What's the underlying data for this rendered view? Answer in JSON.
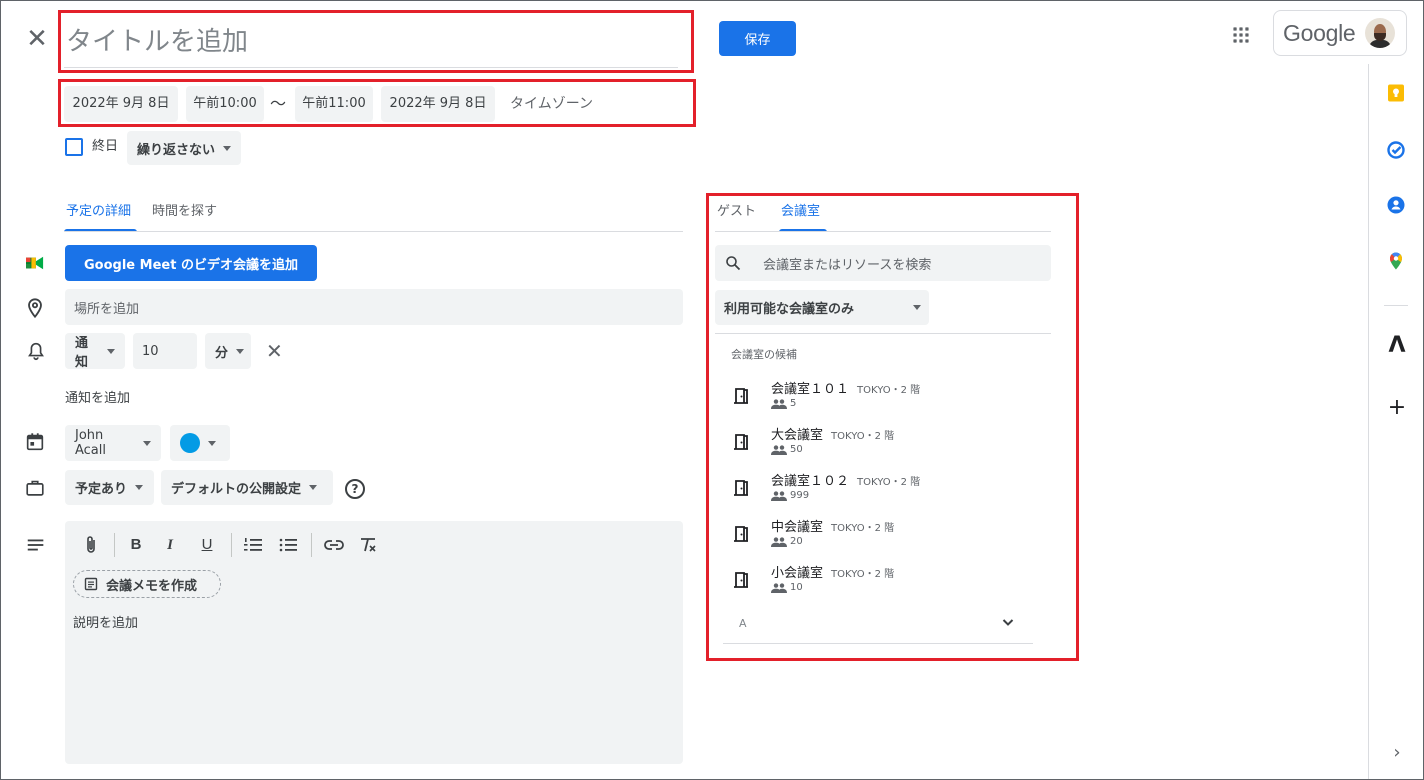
{
  "header": {
    "title_placeholder": "タイトルを追加",
    "save_label": "保存",
    "google_label": "Google"
  },
  "datetime": {
    "start_date": "2022年 9月 8日",
    "start_time": "午前10:00",
    "separator": "〜",
    "end_time": "午前11:00",
    "end_date": "2022年 9月 8日",
    "timezone": "タイムゾーン"
  },
  "options": {
    "all_day_label": "終日",
    "repeat_label": "繰り返さない"
  },
  "left_tabs": [
    {
      "label": "予定の詳細",
      "active": true
    },
    {
      "label": "時間を探す",
      "active": false
    }
  ],
  "details": {
    "meet_button": "Google Meet のビデオ会議を追加",
    "location_placeholder": "場所を追加",
    "notification_type": "通知",
    "notification_value": "10",
    "notification_unit": "分",
    "add_notification": "通知を追加",
    "calendar_owner": "John Acall",
    "calendar_color": "#039be5",
    "availability": "予定あり",
    "visibility": "デフォルトの公開設定",
    "help_glyph": "?"
  },
  "description": {
    "toolbar": [
      "attach-icon",
      "bold-icon",
      "italic-icon",
      "underline-icon",
      "numbered-list-icon",
      "bulleted-list-icon",
      "link-icon",
      "clear-format-icon"
    ],
    "toolbar_glyphs": {
      "bold": "B",
      "italic": "I",
      "underline": "U"
    },
    "notes_button": "会議メモを作成",
    "placeholder": "説明を追加"
  },
  "right_tabs": [
    {
      "label": "ゲスト",
      "active": false
    },
    {
      "label": "会議室",
      "active": true
    }
  ],
  "rooms_panel": {
    "search_placeholder": "会議室またはリソースを検索",
    "filter_label": "利用可能な会議室のみ",
    "section_label": "会議室の候補",
    "rooms": [
      {
        "name": "会議室１０１",
        "location": "TOKYO・2 階",
        "capacity": "5"
      },
      {
        "name": "大会議室",
        "location": "TOKYO・2 階",
        "capacity": "50"
      },
      {
        "name": "会議室１０２",
        "location": "TOKYO・2 階",
        "capacity": "999"
      },
      {
        "name": "中会議室",
        "location": "TOKYO・2 階",
        "capacity": "20"
      },
      {
        "name": "小会議室",
        "location": "TOKYO・2 階",
        "capacity": "10"
      }
    ],
    "more_label": "A"
  },
  "rail": {
    "icons": [
      "keep-icon",
      "tasks-icon",
      "contacts-icon",
      "maps-icon"
    ],
    "lambda_glyph": "Λ",
    "add_glyph": "+",
    "expand_glyph": "›"
  },
  "colors": {
    "accent": "#1a73e8",
    "highlight": "#e3202a"
  }
}
